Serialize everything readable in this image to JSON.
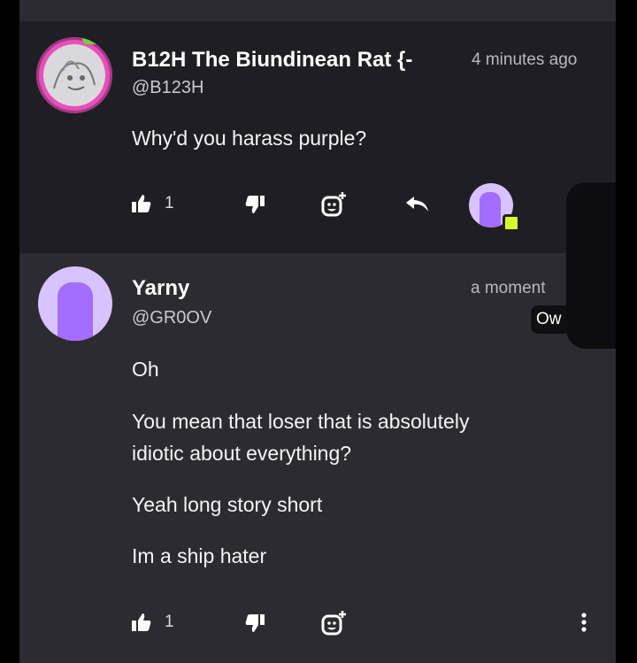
{
  "comments": [
    {
      "username": "B12H The Biundinean Rat {-",
      "handle": "@B123H",
      "timestamp": "4 minutes ago",
      "message_lines": [
        "Why'd you harass purple?"
      ],
      "likes": "1"
    },
    {
      "username": "Yarny",
      "handle": "@GR0OV",
      "timestamp": "a moment",
      "message_lines": [
        "Oh",
        "You mean that loser that is absolutely",
        "idiotic about everything?",
        "Yeah long story short",
        "Im a ship hater"
      ],
      "likes": "1"
    }
  ],
  "overlay": {
    "tooltip_text": "Ow"
  },
  "icons": {
    "like": "thumbs-up-icon",
    "dislike": "thumbs-down-icon",
    "react": "add-reaction-icon",
    "reply": "reply-icon",
    "more": "more-vertical-icon"
  },
  "colors": {
    "background": "#000000",
    "card_dark": "#1f1e24",
    "card": "#2c2b32",
    "online": "#d7ff2c",
    "accent_purple": "#a36dff"
  }
}
